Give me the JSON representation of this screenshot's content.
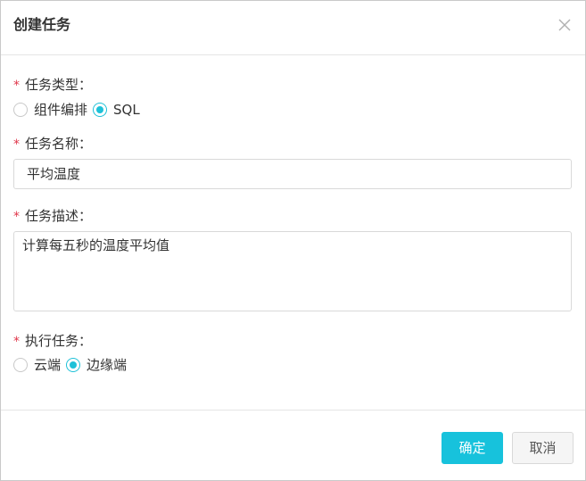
{
  "dialog": {
    "title": "创建任务",
    "close_icon": "close-icon"
  },
  "form": {
    "required_mark": "*",
    "task_type": {
      "label": "任务类型：",
      "options": [
        {
          "label": "组件编排",
          "checked": false
        },
        {
          "label": "SQL",
          "checked": true
        }
      ]
    },
    "task_name": {
      "label": "任务名称：",
      "value": "平均温度"
    },
    "task_desc": {
      "label": "任务描述：",
      "value": "计算每五秒的温度平均值"
    },
    "exec_target": {
      "label": "执行任务：",
      "options": [
        {
          "label": "云端",
          "checked": false
        },
        {
          "label": "边缘端",
          "checked": true
        }
      ]
    }
  },
  "footer": {
    "confirm_label": "确定",
    "cancel_label": "取消"
  },
  "colors": {
    "accent": "#17c2dc",
    "required": "#e0364a"
  }
}
